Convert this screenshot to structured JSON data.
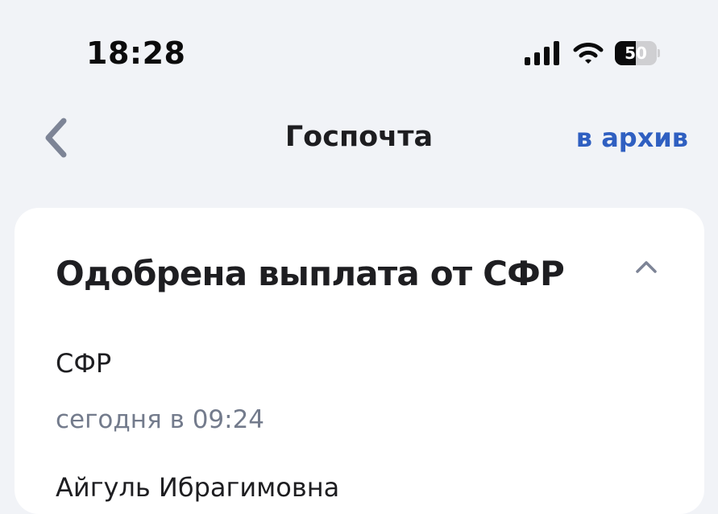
{
  "status_bar": {
    "time": "18:28",
    "battery_level": "50",
    "battery_fraction": 0.5,
    "icons": [
      "cellular-signal-icon",
      "wifi-icon",
      "battery-icon"
    ]
  },
  "header": {
    "back_icon": "chevron-left-icon",
    "title": "Госпочта",
    "archive_label": "в архив"
  },
  "message": {
    "title": "Одобрена выплата от СФР",
    "collapse_icon": "chevron-up-icon",
    "sender": "СФР",
    "date": "сегодня в 09:24",
    "body_preview": "Айгуль Ибрагимовна"
  },
  "colors": {
    "background": "#f1f3f7",
    "card": "#ffffff",
    "accent": "#2f5fc1",
    "secondary_text": "#737b8c",
    "back_icon": "#7d8496"
  }
}
